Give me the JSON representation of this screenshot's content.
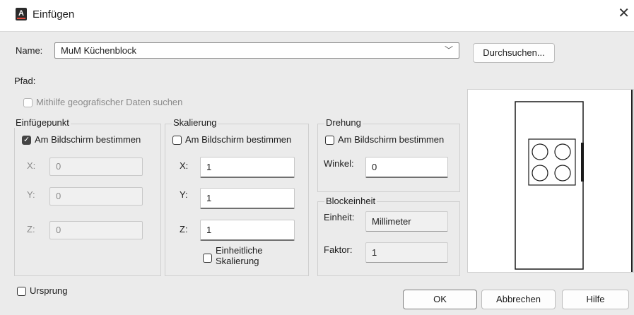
{
  "window": {
    "title": "Einfügen",
    "close_icon": "close-icon"
  },
  "name_row": {
    "label": "Name:",
    "value": "MuM Küchenblock",
    "browse_label": "Durchsuchen..."
  },
  "path": {
    "label": "Pfad:"
  },
  "geo": {
    "label": "Mithilfe geografischer Daten suchen",
    "checked": false,
    "enabled": false
  },
  "insertion_point": {
    "legend": "Einfügepunkt",
    "on_screen_label": "Am Bildschirm bestimmen",
    "on_screen_checked": true,
    "x_label": "X:",
    "x_value": "0",
    "y_label": "Y:",
    "y_value": "0",
    "z_label": "Z:",
    "z_value": "0"
  },
  "scale": {
    "legend": "Skalierung",
    "on_screen_label": "Am Bildschirm bestimmen",
    "on_screen_checked": false,
    "x_label": "X:",
    "x_value": "1",
    "y_label": "Y:",
    "y_value": "1",
    "z_label": "Z:",
    "z_value": "1",
    "uniform_line1": "Einheitliche",
    "uniform_line2": "Skalierung",
    "uniform_checked": false
  },
  "rotation": {
    "legend": "Drehung",
    "on_screen_label": "Am Bildschirm bestimmen",
    "on_screen_checked": false,
    "angle_label": "Winkel:",
    "angle_value": "0"
  },
  "block_unit": {
    "legend": "Blockeinheit",
    "unit_label": "Einheit:",
    "unit_value": "Millimeter",
    "factor_label": "Faktor:",
    "factor_value": "1"
  },
  "origin": {
    "label": "Ursprung",
    "checked": false
  },
  "buttons": {
    "ok": "OK",
    "cancel": "Abbrechen",
    "help": "Hilfe"
  },
  "colors": {
    "dialog_bg": "#ebebeb",
    "checkbox_checked": "#444444"
  }
}
